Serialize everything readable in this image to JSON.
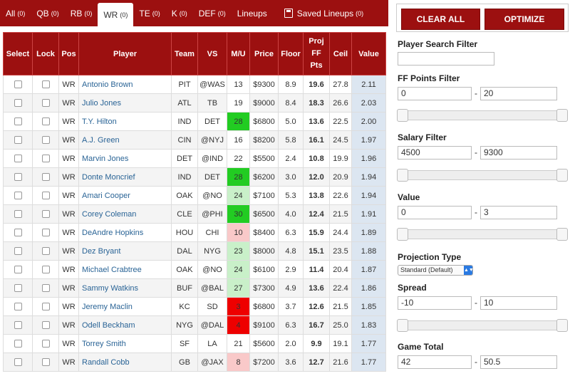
{
  "tabs": [
    {
      "label": "All",
      "count": "(0)"
    },
    {
      "label": "QB",
      "count": "(0)"
    },
    {
      "label": "RB",
      "count": "(0)"
    },
    {
      "label": "WR",
      "count": "(0)"
    },
    {
      "label": "TE",
      "count": "(0)"
    },
    {
      "label": "K",
      "count": "(0)"
    },
    {
      "label": "DEF",
      "count": "(0)"
    },
    {
      "label": "Lineups",
      "count": ""
    },
    {
      "label": "Saved Lineups",
      "count": "(0)"
    }
  ],
  "columns": [
    "Select",
    "Lock",
    "Pos",
    "Player",
    "Team",
    "VS",
    "M/U",
    "Price",
    "Floor",
    "Proj FF Pts",
    "Ceil",
    "Value"
  ],
  "players": [
    {
      "pos": "WR",
      "name": "Antonio Brown",
      "team": "PIT",
      "vs": "@WAS",
      "mu": "13",
      "price": "$9300",
      "floor": "8.9",
      "proj": "19.6",
      "ceil": "27.8",
      "value": "2.11"
    },
    {
      "pos": "WR",
      "name": "Julio Jones",
      "team": "ATL",
      "vs": "TB",
      "mu": "19",
      "price": "$9000",
      "floor": "8.4",
      "proj": "18.3",
      "ceil": "26.6",
      "value": "2.03"
    },
    {
      "pos": "WR",
      "name": "T.Y. Hilton",
      "team": "IND",
      "vs": "DET",
      "mu": "28",
      "price": "$6800",
      "floor": "5.0",
      "proj": "13.6",
      "ceil": "22.5",
      "value": "2.00"
    },
    {
      "pos": "WR",
      "name": "A.J. Green",
      "team": "CIN",
      "vs": "@NYJ",
      "mu": "16",
      "price": "$8200",
      "floor": "5.8",
      "proj": "16.1",
      "ceil": "24.5",
      "value": "1.97"
    },
    {
      "pos": "WR",
      "name": "Marvin Jones",
      "team": "DET",
      "vs": "@IND",
      "mu": "22",
      "price": "$5500",
      "floor": "2.4",
      "proj": "10.8",
      "ceil": "19.9",
      "value": "1.96"
    },
    {
      "pos": "WR",
      "name": "Donte Moncrief",
      "team": "IND",
      "vs": "DET",
      "mu": "28",
      "price": "$6200",
      "floor": "3.0",
      "proj": "12.0",
      "ceil": "20.9",
      "value": "1.94"
    },
    {
      "pos": "WR",
      "name": "Amari Cooper",
      "team": "OAK",
      "vs": "@NO",
      "mu": "24",
      "price": "$7100",
      "floor": "5.3",
      "proj": "13.8",
      "ceil": "22.6",
      "value": "1.94"
    },
    {
      "pos": "WR",
      "name": "Corey Coleman",
      "team": "CLE",
      "vs": "@PHI",
      "mu": "30",
      "price": "$6500",
      "floor": "4.0",
      "proj": "12.4",
      "ceil": "21.5",
      "value": "1.91"
    },
    {
      "pos": "WR",
      "name": "DeAndre Hopkins",
      "team": "HOU",
      "vs": "CHI",
      "mu": "10",
      "price": "$8400",
      "floor": "6.3",
      "proj": "15.9",
      "ceil": "24.4",
      "value": "1.89"
    },
    {
      "pos": "WR",
      "name": "Dez Bryant",
      "team": "DAL",
      "vs": "NYG",
      "mu": "23",
      "price": "$8000",
      "floor": "4.8",
      "proj": "15.1",
      "ceil": "23.5",
      "value": "1.88"
    },
    {
      "pos": "WR",
      "name": "Michael Crabtree",
      "team": "OAK",
      "vs": "@NO",
      "mu": "24",
      "price": "$6100",
      "floor": "2.9",
      "proj": "11.4",
      "ceil": "20.4",
      "value": "1.87"
    },
    {
      "pos": "WR",
      "name": "Sammy Watkins",
      "team": "BUF",
      "vs": "@BAL",
      "mu": "27",
      "price": "$7300",
      "floor": "4.9",
      "proj": "13.6",
      "ceil": "22.4",
      "value": "1.86"
    },
    {
      "pos": "WR",
      "name": "Jeremy Maclin",
      "team": "KC",
      "vs": "SD",
      "mu": "3",
      "price": "$6800",
      "floor": "3.7",
      "proj": "12.6",
      "ceil": "21.5",
      "value": "1.85"
    },
    {
      "pos": "WR",
      "name": "Odell Beckham",
      "team": "NYG",
      "vs": "@DAL",
      "mu": "4",
      "price": "$9100",
      "floor": "6.3",
      "proj": "16.7",
      "ceil": "25.0",
      "value": "1.83"
    },
    {
      "pos": "WR",
      "name": "Torrey Smith",
      "team": "SF",
      "vs": "LA",
      "mu": "21",
      "price": "$5600",
      "floor": "2.0",
      "proj": "9.9",
      "ceil": "19.1",
      "value": "1.77"
    },
    {
      "pos": "WR",
      "name": "Randall Cobb",
      "team": "GB",
      "vs": "@JAX",
      "mu": "8",
      "price": "$7200",
      "floor": "3.6",
      "proj": "12.7",
      "ceil": "21.6",
      "value": "1.77"
    }
  ],
  "colors": {
    "brand": "#9c1010",
    "mu_great": "#22cc22",
    "mu_good": "#c9f0c9",
    "mu_neutral": "#ffffff",
    "mu_poor": "#f9c9c9",
    "mu_bad": "#ee0000",
    "value_col": "#dce6f1"
  },
  "sidebar": {
    "clear_all": "CLEAR ALL",
    "optimize": "OPTIMIZE",
    "player_search_label": "Player Search Filter",
    "player_search_value": "",
    "ff_points_label": "FF Points Filter",
    "ff_points_min": "0",
    "ff_points_max": "20",
    "salary_label": "Salary Filter",
    "salary_min": "4500",
    "salary_max": "9300",
    "value_label": "Value",
    "value_min": "0",
    "value_max": "3",
    "projection_type_label": "Projection Type",
    "projection_type_value": "Standard (Default)",
    "spread_label": "Spread",
    "spread_min": "-10",
    "spread_max": "10",
    "game_total_label": "Game Total",
    "game_total_min": "42",
    "game_total_max": "50.5",
    "dash": "-"
  }
}
